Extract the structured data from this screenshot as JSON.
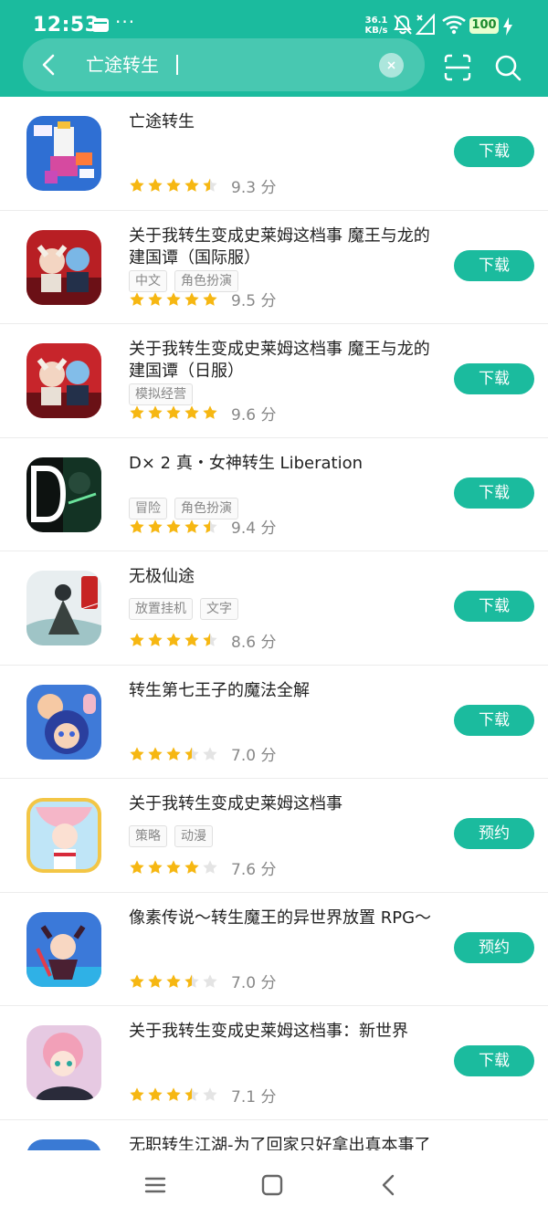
{
  "status_bar": {
    "time": "12:53",
    "dots": "···",
    "speed_value": "36.1",
    "speed_unit": "KB/s",
    "battery": "100"
  },
  "search": {
    "query": "亡途转生"
  },
  "colors": {
    "accent": "#1bbb9e",
    "star": "#f6b712",
    "star_empty": "#e4e4e4"
  },
  "apps": [
    {
      "title": "亡途转生",
      "tags": [],
      "rating": 4.5,
      "score": "9.3 分",
      "action": "下载",
      "icon": "pixel-anime-icon"
    },
    {
      "title": "关于我转生变成史莱姆这档事 魔王与龙的建国谭（国际服）",
      "tags": [
        "中文",
        "角色扮演"
      ],
      "rating": 5,
      "score": "9.5 分",
      "action": "下载",
      "icon": "anime-event-icon"
    },
    {
      "title": "关于我转生变成史莱姆这档事 魔王与龙的建国谭（日服）",
      "tags": [
        "模拟经营"
      ],
      "rating": 5,
      "score": "9.6 分",
      "action": "下载",
      "icon": "anime-event-jp-icon"
    },
    {
      "title": "D× 2  真・女神转生 Liberation",
      "tags": [
        "冒险",
        "角色扮演"
      ],
      "rating": 4.5,
      "score": "9.4 分",
      "action": "下载",
      "icon": "dx2-icon"
    },
    {
      "title": "无极仙途",
      "tags": [
        "放置挂机",
        "文字"
      ],
      "rating": 4.5,
      "score": "8.6 分",
      "action": "下载",
      "icon": "immortal-icon"
    },
    {
      "title": "转生第七王子的魔法全解",
      "tags": [],
      "rating": 3.5,
      "score": "7.0 分",
      "action": "下载",
      "icon": "seventh-prince-icon"
    },
    {
      "title": "关于我转生变成史莱姆这档事",
      "tags": [
        "策略",
        "动漫"
      ],
      "rating": 4,
      "score": "7.6 分",
      "action": "预约",
      "icon": "slime-girl-icon"
    },
    {
      "title": "像素传说～转生魔王的异世界放置 RPG～",
      "tags": [],
      "rating": 3.5,
      "score": "7.0 分",
      "action": "预约",
      "icon": "demon-king-icon"
    },
    {
      "title": "关于我转生变成史莱姆这档事：新世界",
      "tags": [],
      "rating": 3.5,
      "score": "7.1 分",
      "action": "下载",
      "icon": "slime-new-world-icon"
    },
    {
      "title": "无职转生江湖-为了回家只好拿出真本事了",
      "tags": [],
      "rating": 0,
      "score": "",
      "action": "",
      "icon": "jianghu-icon"
    }
  ]
}
